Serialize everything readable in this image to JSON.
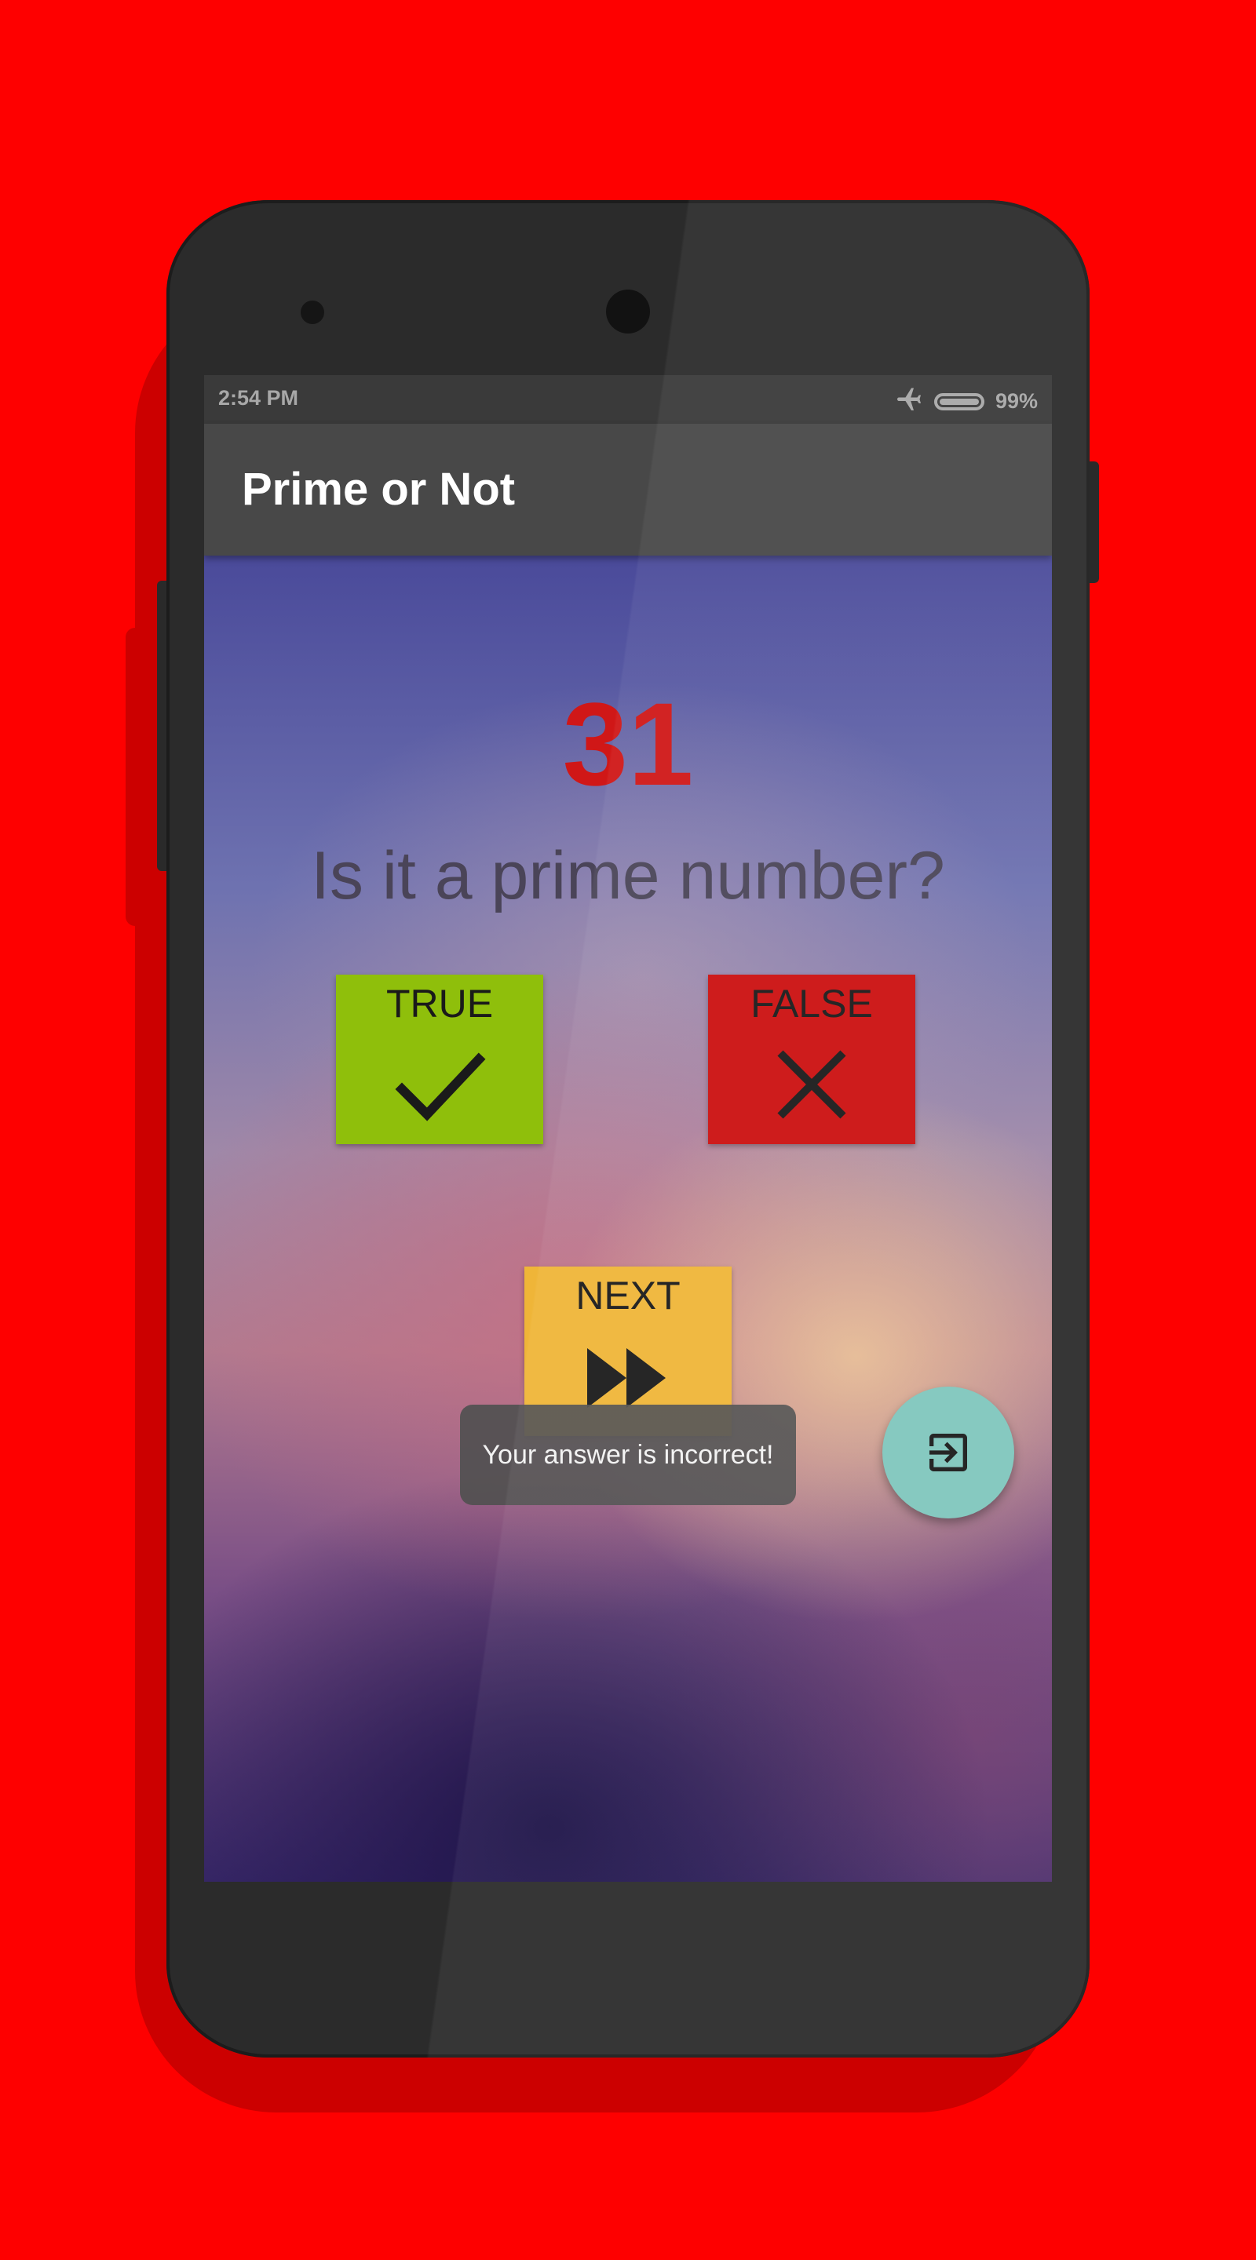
{
  "status_bar": {
    "time": "2:54 PM",
    "battery": "99%",
    "icons": [
      "airplane-icon",
      "battery-icon"
    ]
  },
  "app_bar": {
    "title": "Prime or Not"
  },
  "game": {
    "number": "31",
    "question": "Is it a prime number?"
  },
  "buttons": {
    "true_label": "TRUE",
    "false_label": "FALSE",
    "next_label": "NEXT"
  },
  "toast": {
    "message": "Your answer is incorrect!"
  },
  "fab": {
    "icon": "exit-to-app-icon"
  },
  "colors": {
    "background": "#fe0000",
    "number": "#d01717",
    "true_button": "#8fbf0b",
    "false_button": "#cb1010",
    "next_button": "#efb538",
    "fab": "#7fc6bd",
    "app_bar": "#484848"
  }
}
